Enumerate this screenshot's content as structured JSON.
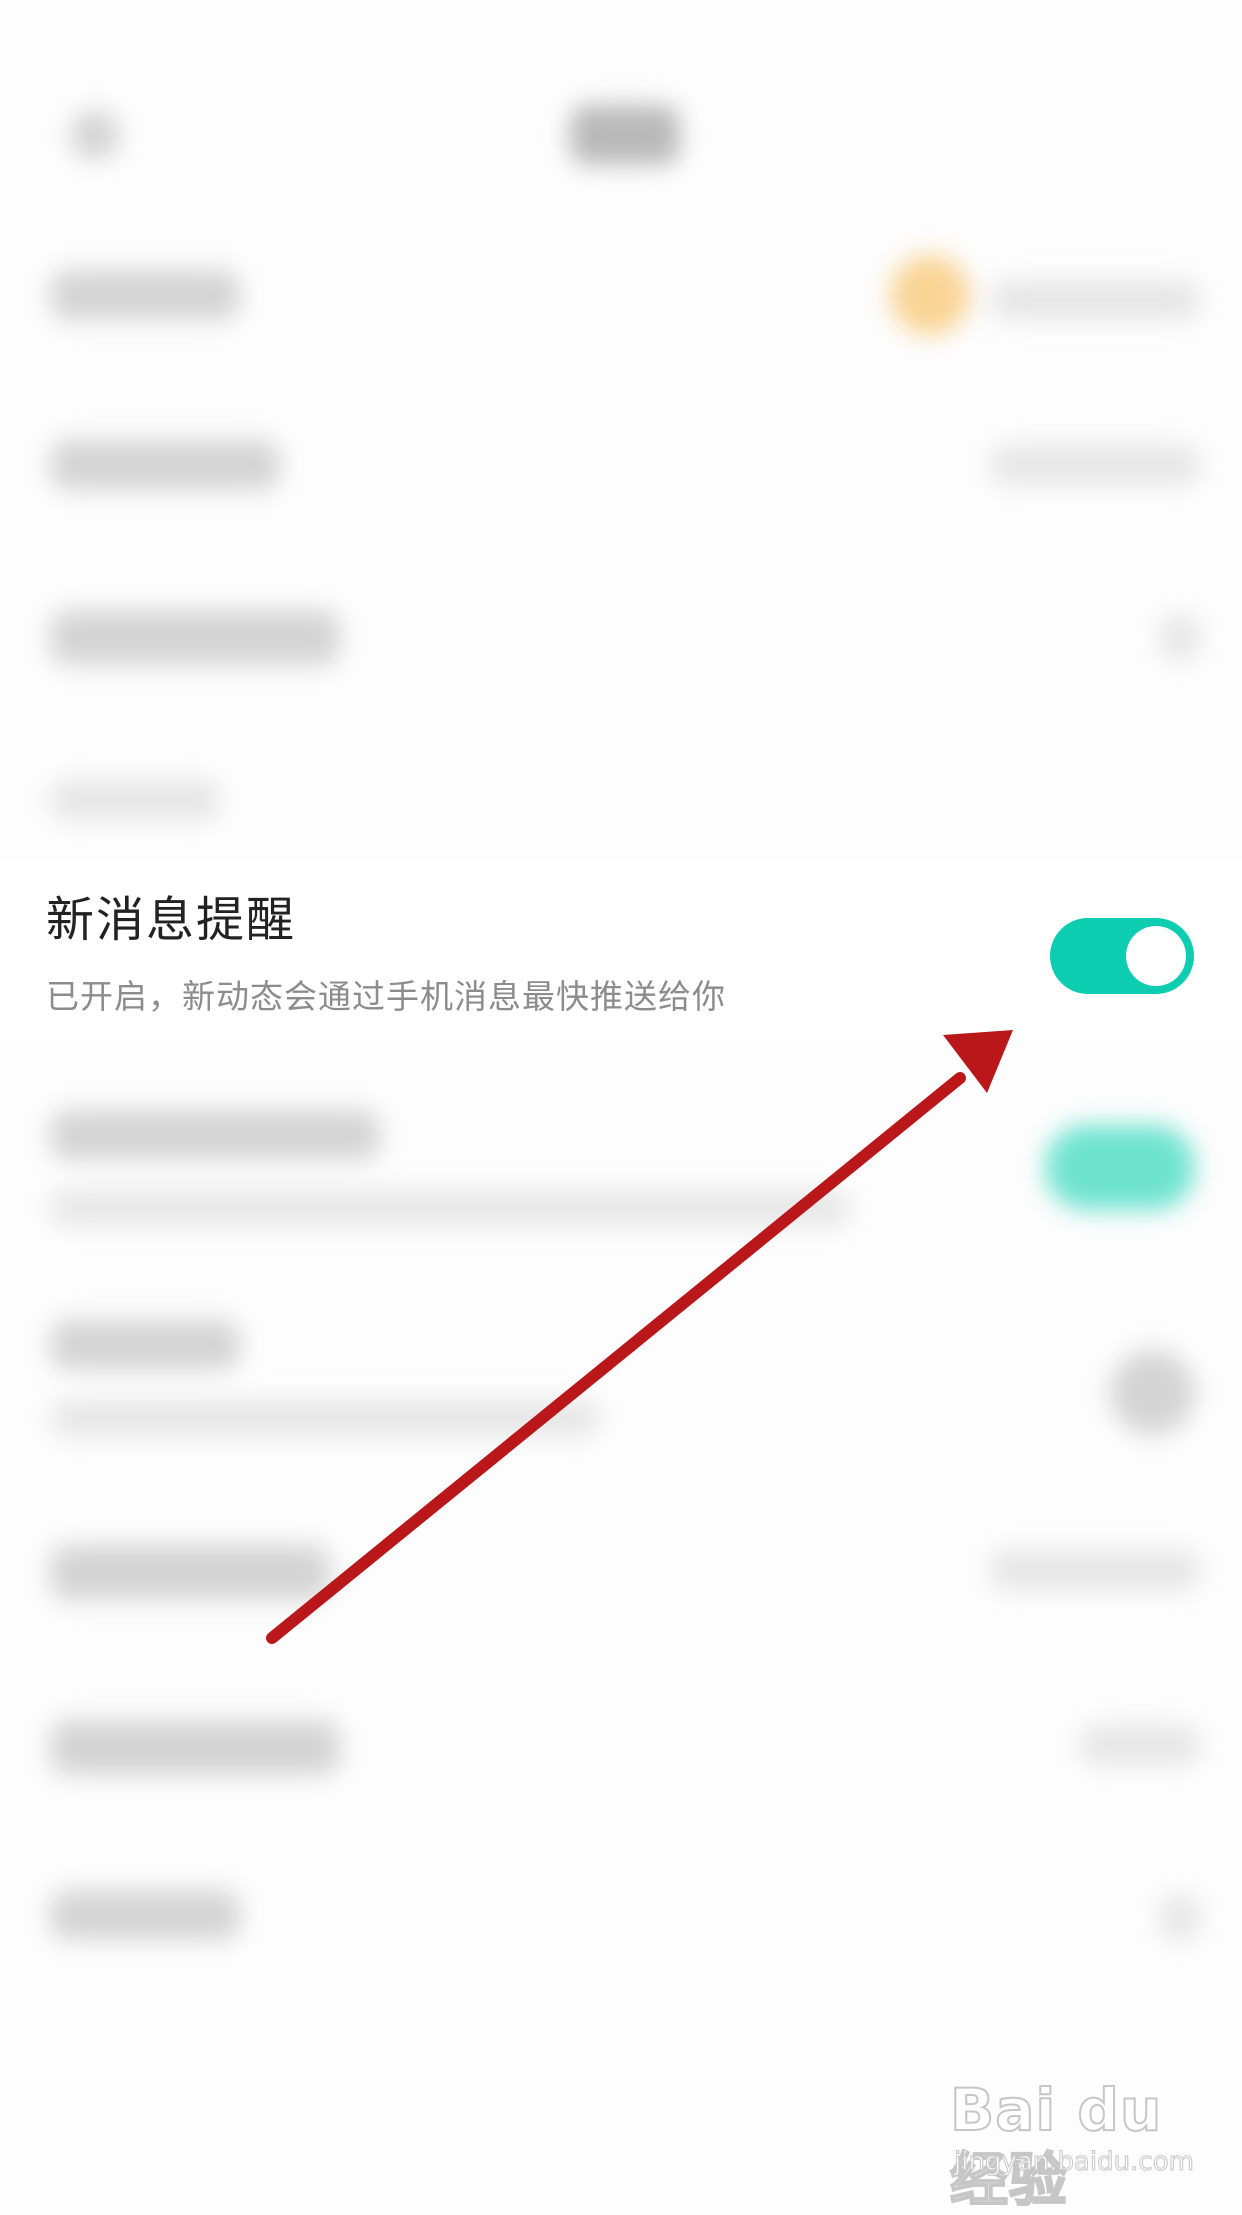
{
  "setting": {
    "title": "新消息提醒",
    "description": "已开启，新动态会通过手机消息最快推送给你",
    "enabled": true
  },
  "watermark": {
    "logo": "Bai du 经验",
    "url": "jingyan.baidu.com"
  },
  "colors": {
    "toggle_on": "#0dcdb0",
    "arrow": "#b9171a",
    "title_text": "#222222",
    "description_text": "#8c8c8c"
  }
}
